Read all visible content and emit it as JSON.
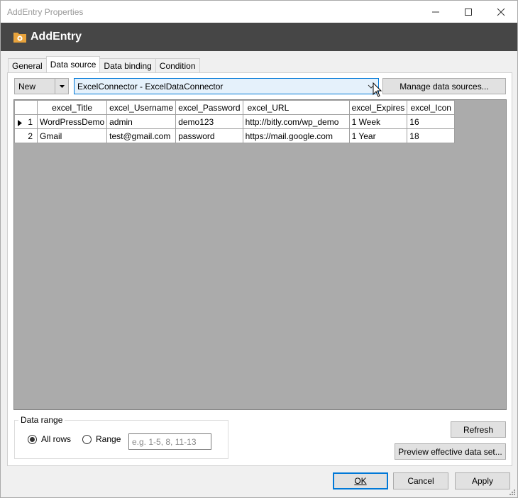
{
  "window": {
    "title": "AddEntry Properties",
    "header_title": "AddEntry"
  },
  "tabs": [
    {
      "label": "General"
    },
    {
      "label": "Data source"
    },
    {
      "label": "Data binding"
    },
    {
      "label": "Condition"
    }
  ],
  "active_tab": "Data source",
  "toolbar": {
    "new_label": "New",
    "data_source_selected": "ExcelConnector  -  ExcelDataConnector",
    "manage_label": "Manage data sources..."
  },
  "grid": {
    "columns": [
      "excel_Title",
      "excel_Username",
      "excel_Password",
      "excel_URL",
      "excel_Expires",
      "excel_Icon"
    ],
    "rows": [
      {
        "num": "1",
        "cells": [
          "WordPressDemo",
          "admin",
          "demo123",
          "http://bitly.com/wp_demo",
          "1 Week",
          "16"
        ]
      },
      {
        "num": "2",
        "cells": [
          "Gmail",
          "test@gmail.com",
          "password",
          "https://mail.google.com",
          "1 Year",
          "18"
        ]
      }
    ]
  },
  "data_range": {
    "legend": "Data range",
    "all_rows_label": "All rows",
    "range_label": "Range",
    "range_placeholder": "e.g. 1-5, 8, 11-13",
    "range_value": "",
    "selected": "All rows"
  },
  "side_buttons": {
    "refresh_label": "Refresh",
    "preview_label": "Preview effective data set..."
  },
  "footer": {
    "ok_label": "OK",
    "cancel_label": "Cancel",
    "apply_label": "Apply"
  },
  "colors": {
    "header_bg": "#464646",
    "grid_bg": "#ababab",
    "focus_blue": "#0078d7",
    "combo_bg": "#e5f1fb",
    "logo_orange": "#e8a33c"
  }
}
